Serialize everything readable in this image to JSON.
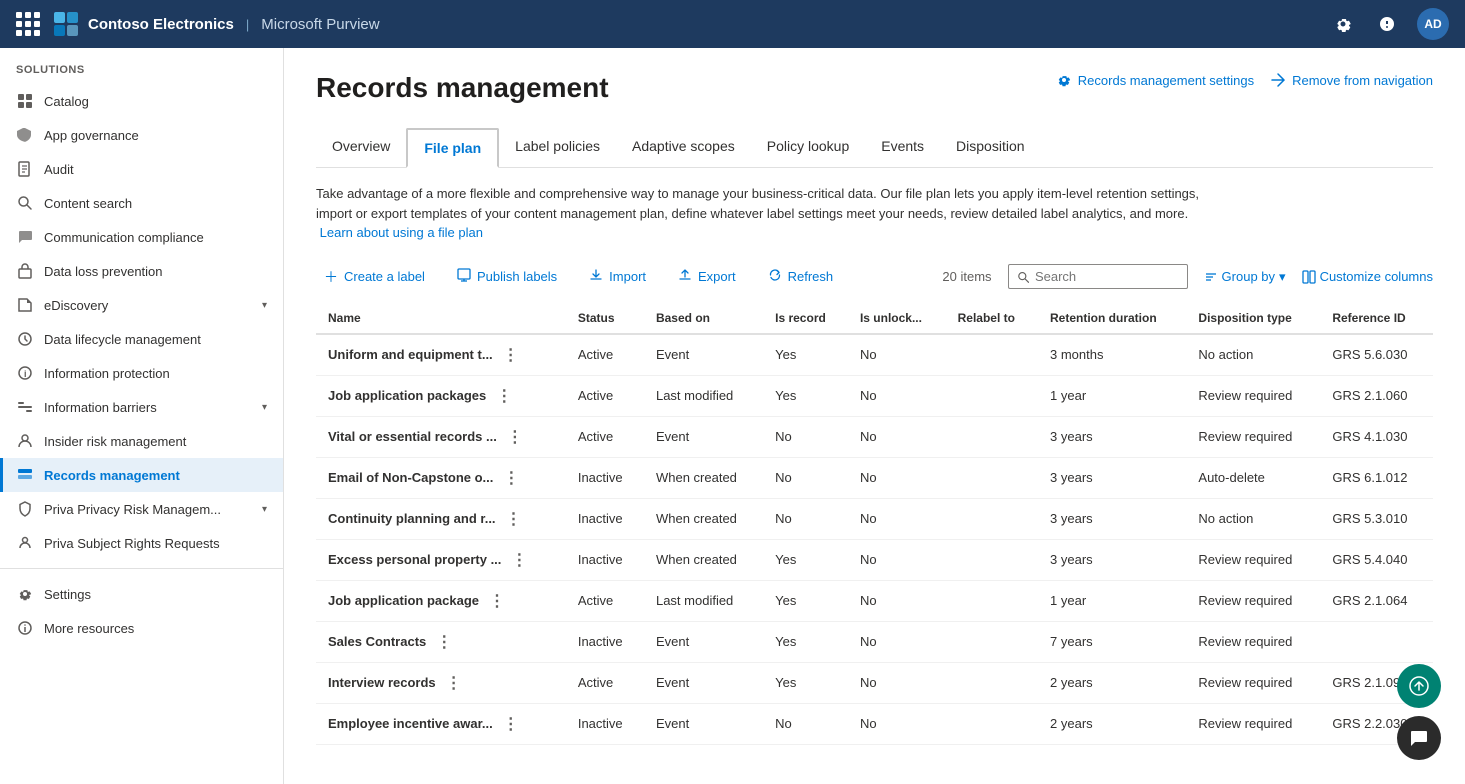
{
  "topnav": {
    "brand": "Contoso Electronics",
    "separator": "|",
    "app": "Microsoft Purview",
    "avatar_initials": "AD"
  },
  "sidebar": {
    "section_label": "Solutions",
    "items": [
      {
        "id": "catalog",
        "label": "Catalog",
        "icon": "grid"
      },
      {
        "id": "app-governance",
        "label": "App governance",
        "icon": "shield"
      },
      {
        "id": "audit",
        "label": "Audit",
        "icon": "doc"
      },
      {
        "id": "content-search",
        "label": "Content search",
        "icon": "search"
      },
      {
        "id": "communication-compliance",
        "label": "Communication compliance",
        "icon": "chat"
      },
      {
        "id": "data-loss-prevention",
        "label": "Data loss prevention",
        "icon": "lock"
      },
      {
        "id": "ediscovery",
        "label": "eDiscovery",
        "icon": "folder",
        "has_chevron": true
      },
      {
        "id": "data-lifecycle",
        "label": "Data lifecycle management",
        "icon": "cycle"
      },
      {
        "id": "information-protection",
        "label": "Information protection",
        "icon": "info"
      },
      {
        "id": "information-barriers",
        "label": "Information barriers",
        "icon": "barrier",
        "has_chevron": true
      },
      {
        "id": "insider-risk",
        "label": "Insider risk management",
        "icon": "person"
      },
      {
        "id": "records-management",
        "label": "Records management",
        "icon": "records",
        "active": true
      },
      {
        "id": "priva-privacy",
        "label": "Priva Privacy Risk Managem...",
        "icon": "privacy",
        "has_chevron": true
      },
      {
        "id": "priva-subject",
        "label": "Priva Subject Rights Requests",
        "icon": "rights"
      }
    ],
    "bottom_items": [
      {
        "id": "settings",
        "label": "Settings",
        "icon": "gear"
      },
      {
        "id": "more-resources",
        "label": "More resources",
        "icon": "info-circle"
      }
    ]
  },
  "page": {
    "title": "Records management",
    "settings_link": "Records management settings",
    "nav_link": "Remove from navigation",
    "description": "Take advantage of a more flexible and comprehensive way to manage your business-critical data. Our file plan lets you apply item-level retention settings, import or export templates of your content management plan, define whatever label settings meet your needs, review detailed label analytics, and more.",
    "description_link": "Learn about using a file plan"
  },
  "tabs": [
    {
      "id": "overview",
      "label": "Overview",
      "active": false
    },
    {
      "id": "file-plan",
      "label": "File plan",
      "active": true
    },
    {
      "id": "label-policies",
      "label": "Label policies",
      "active": false
    },
    {
      "id": "adaptive-scopes",
      "label": "Adaptive scopes",
      "active": false
    },
    {
      "id": "policy-lookup",
      "label": "Policy lookup",
      "active": false
    },
    {
      "id": "events",
      "label": "Events",
      "active": false
    },
    {
      "id": "disposition",
      "label": "Disposition",
      "active": false
    }
  ],
  "toolbar": {
    "create_label": "Create a label",
    "publish_labels": "Publish labels",
    "import": "Import",
    "export": "Export",
    "refresh": "Refresh",
    "items_count": "20 items",
    "search_placeholder": "Search",
    "group_by": "Group by",
    "customize_columns": "Customize columns"
  },
  "table": {
    "columns": [
      "Name",
      "Status",
      "Based on",
      "Is record",
      "Is unlock...",
      "Relabel to",
      "Retention duration",
      "Disposition type",
      "Reference ID"
    ],
    "rows": [
      {
        "name": "Uniform and equipment t...",
        "status": "Active",
        "based_on": "Event",
        "is_record": "Yes",
        "is_unlocked": "No",
        "relabel_to": "",
        "retention": "3 months",
        "disposition": "No action",
        "ref_id": "GRS 5.6.030"
      },
      {
        "name": "Job application packages",
        "status": "Active",
        "based_on": "Last modified",
        "is_record": "Yes",
        "is_unlocked": "No",
        "relabel_to": "",
        "retention": "1 year",
        "disposition": "Review required",
        "ref_id": "GRS 2.1.060"
      },
      {
        "name": "Vital or essential records ...",
        "status": "Active",
        "based_on": "Event",
        "is_record": "No",
        "is_unlocked": "No",
        "relabel_to": "",
        "retention": "3 years",
        "disposition": "Review required",
        "ref_id": "GRS 4.1.030"
      },
      {
        "name": "Email of Non-Capstone o...",
        "status": "Inactive",
        "based_on": "When created",
        "is_record": "No",
        "is_unlocked": "No",
        "relabel_to": "",
        "retention": "3 years",
        "disposition": "Auto-delete",
        "ref_id": "GRS 6.1.012"
      },
      {
        "name": "Continuity planning and r...",
        "status": "Inactive",
        "based_on": "When created",
        "is_record": "No",
        "is_unlocked": "No",
        "relabel_to": "",
        "retention": "3 years",
        "disposition": "No action",
        "ref_id": "GRS 5.3.010"
      },
      {
        "name": "Excess personal property ...",
        "status": "Inactive",
        "based_on": "When created",
        "is_record": "Yes",
        "is_unlocked": "No",
        "relabel_to": "",
        "retention": "3 years",
        "disposition": "Review required",
        "ref_id": "GRS 5.4.040"
      },
      {
        "name": "Job application package",
        "status": "Active",
        "based_on": "Last modified",
        "is_record": "Yes",
        "is_unlocked": "No",
        "relabel_to": "",
        "retention": "1 year",
        "disposition": "Review required",
        "ref_id": "GRS 2.1.064"
      },
      {
        "name": "Sales Contracts",
        "status": "Inactive",
        "based_on": "Event",
        "is_record": "Yes",
        "is_unlocked": "No",
        "relabel_to": "",
        "retention": "7 years",
        "disposition": "Review required",
        "ref_id": ""
      },
      {
        "name": "Interview records",
        "status": "Active",
        "based_on": "Event",
        "is_record": "Yes",
        "is_unlocked": "No",
        "relabel_to": "",
        "retention": "2 years",
        "disposition": "Review required",
        "ref_id": "GRS 2.1.090"
      },
      {
        "name": "Employee incentive awar...",
        "status": "Inactive",
        "based_on": "Event",
        "is_record": "No",
        "is_unlocked": "No",
        "relabel_to": "",
        "retention": "2 years",
        "disposition": "Review required",
        "ref_id": "GRS 2.2.030"
      }
    ]
  },
  "fab": {
    "icon1": "↑",
    "icon2": "💬"
  }
}
